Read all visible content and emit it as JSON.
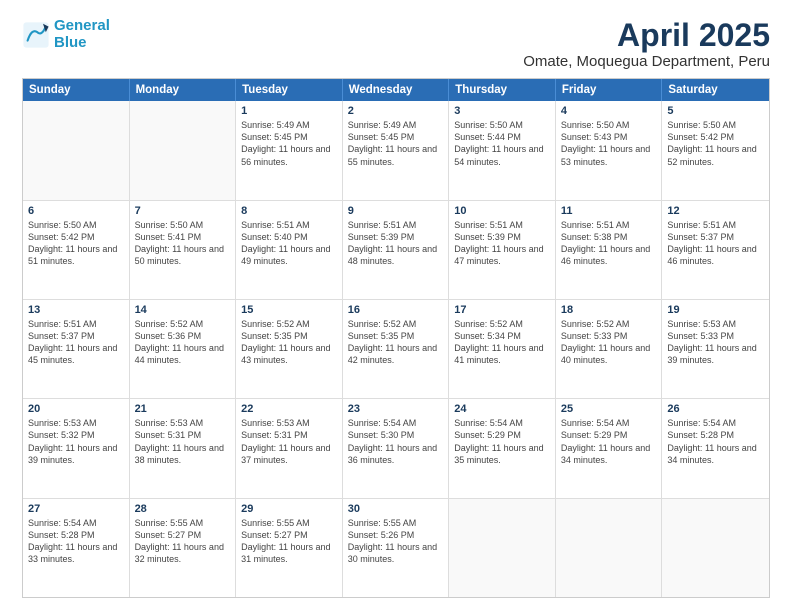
{
  "logo": {
    "line1": "General",
    "line2": "Blue"
  },
  "title": "April 2025",
  "subtitle": "Omate, Moquegua Department, Peru",
  "header_days": [
    "Sunday",
    "Monday",
    "Tuesday",
    "Wednesday",
    "Thursday",
    "Friday",
    "Saturday"
  ],
  "weeks": [
    [
      {
        "day": "",
        "text": ""
      },
      {
        "day": "",
        "text": ""
      },
      {
        "day": "1",
        "text": "Sunrise: 5:49 AM\nSunset: 5:45 PM\nDaylight: 11 hours and 56 minutes."
      },
      {
        "day": "2",
        "text": "Sunrise: 5:49 AM\nSunset: 5:45 PM\nDaylight: 11 hours and 55 minutes."
      },
      {
        "day": "3",
        "text": "Sunrise: 5:50 AM\nSunset: 5:44 PM\nDaylight: 11 hours and 54 minutes."
      },
      {
        "day": "4",
        "text": "Sunrise: 5:50 AM\nSunset: 5:43 PM\nDaylight: 11 hours and 53 minutes."
      },
      {
        "day": "5",
        "text": "Sunrise: 5:50 AM\nSunset: 5:42 PM\nDaylight: 11 hours and 52 minutes."
      }
    ],
    [
      {
        "day": "6",
        "text": "Sunrise: 5:50 AM\nSunset: 5:42 PM\nDaylight: 11 hours and 51 minutes."
      },
      {
        "day": "7",
        "text": "Sunrise: 5:50 AM\nSunset: 5:41 PM\nDaylight: 11 hours and 50 minutes."
      },
      {
        "day": "8",
        "text": "Sunrise: 5:51 AM\nSunset: 5:40 PM\nDaylight: 11 hours and 49 minutes."
      },
      {
        "day": "9",
        "text": "Sunrise: 5:51 AM\nSunset: 5:39 PM\nDaylight: 11 hours and 48 minutes."
      },
      {
        "day": "10",
        "text": "Sunrise: 5:51 AM\nSunset: 5:39 PM\nDaylight: 11 hours and 47 minutes."
      },
      {
        "day": "11",
        "text": "Sunrise: 5:51 AM\nSunset: 5:38 PM\nDaylight: 11 hours and 46 minutes."
      },
      {
        "day": "12",
        "text": "Sunrise: 5:51 AM\nSunset: 5:37 PM\nDaylight: 11 hours and 46 minutes."
      }
    ],
    [
      {
        "day": "13",
        "text": "Sunrise: 5:51 AM\nSunset: 5:37 PM\nDaylight: 11 hours and 45 minutes."
      },
      {
        "day": "14",
        "text": "Sunrise: 5:52 AM\nSunset: 5:36 PM\nDaylight: 11 hours and 44 minutes."
      },
      {
        "day": "15",
        "text": "Sunrise: 5:52 AM\nSunset: 5:35 PM\nDaylight: 11 hours and 43 minutes."
      },
      {
        "day": "16",
        "text": "Sunrise: 5:52 AM\nSunset: 5:35 PM\nDaylight: 11 hours and 42 minutes."
      },
      {
        "day": "17",
        "text": "Sunrise: 5:52 AM\nSunset: 5:34 PM\nDaylight: 11 hours and 41 minutes."
      },
      {
        "day": "18",
        "text": "Sunrise: 5:52 AM\nSunset: 5:33 PM\nDaylight: 11 hours and 40 minutes."
      },
      {
        "day": "19",
        "text": "Sunrise: 5:53 AM\nSunset: 5:33 PM\nDaylight: 11 hours and 39 minutes."
      }
    ],
    [
      {
        "day": "20",
        "text": "Sunrise: 5:53 AM\nSunset: 5:32 PM\nDaylight: 11 hours and 39 minutes."
      },
      {
        "day": "21",
        "text": "Sunrise: 5:53 AM\nSunset: 5:31 PM\nDaylight: 11 hours and 38 minutes."
      },
      {
        "day": "22",
        "text": "Sunrise: 5:53 AM\nSunset: 5:31 PM\nDaylight: 11 hours and 37 minutes."
      },
      {
        "day": "23",
        "text": "Sunrise: 5:54 AM\nSunset: 5:30 PM\nDaylight: 11 hours and 36 minutes."
      },
      {
        "day": "24",
        "text": "Sunrise: 5:54 AM\nSunset: 5:29 PM\nDaylight: 11 hours and 35 minutes."
      },
      {
        "day": "25",
        "text": "Sunrise: 5:54 AM\nSunset: 5:29 PM\nDaylight: 11 hours and 34 minutes."
      },
      {
        "day": "26",
        "text": "Sunrise: 5:54 AM\nSunset: 5:28 PM\nDaylight: 11 hours and 34 minutes."
      }
    ],
    [
      {
        "day": "27",
        "text": "Sunrise: 5:54 AM\nSunset: 5:28 PM\nDaylight: 11 hours and 33 minutes."
      },
      {
        "day": "28",
        "text": "Sunrise: 5:55 AM\nSunset: 5:27 PM\nDaylight: 11 hours and 32 minutes."
      },
      {
        "day": "29",
        "text": "Sunrise: 5:55 AM\nSunset: 5:27 PM\nDaylight: 11 hours and 31 minutes."
      },
      {
        "day": "30",
        "text": "Sunrise: 5:55 AM\nSunset: 5:26 PM\nDaylight: 11 hours and 30 minutes."
      },
      {
        "day": "",
        "text": ""
      },
      {
        "day": "",
        "text": ""
      },
      {
        "day": "",
        "text": ""
      }
    ]
  ]
}
